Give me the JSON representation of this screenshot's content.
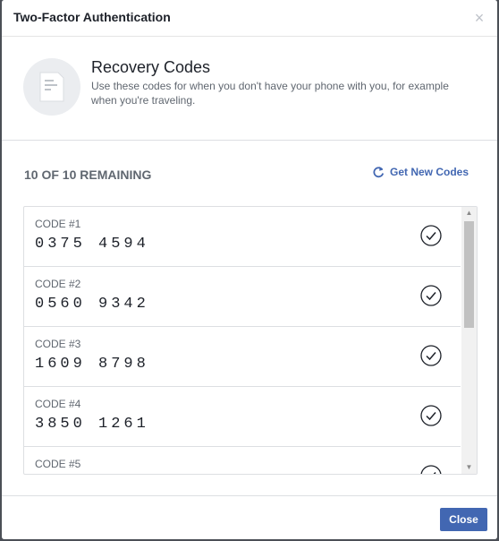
{
  "dialog": {
    "title": "Two-Factor Authentication",
    "close_glyph": "×"
  },
  "header": {
    "icon": "document-icon",
    "title": "Recovery Codes",
    "description": "Use these codes for when you don't have your phone with you, for example when you're traveling."
  },
  "status": {
    "remaining": "10 OF 10 REMAINING",
    "get_new_label": "Get New Codes"
  },
  "codes": [
    {
      "label": "CODE #1",
      "value": "0375 4594"
    },
    {
      "label": "CODE #2",
      "value": "0560 9342"
    },
    {
      "label": "CODE #3",
      "value": "1609 8798"
    },
    {
      "label": "CODE #4",
      "value": "3850 1261"
    },
    {
      "label": "CODE #5",
      "value": ""
    }
  ],
  "footer": {
    "close_label": "Close"
  },
  "colors": {
    "accent": "#4267b2",
    "text_primary": "#1d2129",
    "text_secondary": "#606770",
    "border": "#dddfe2"
  }
}
